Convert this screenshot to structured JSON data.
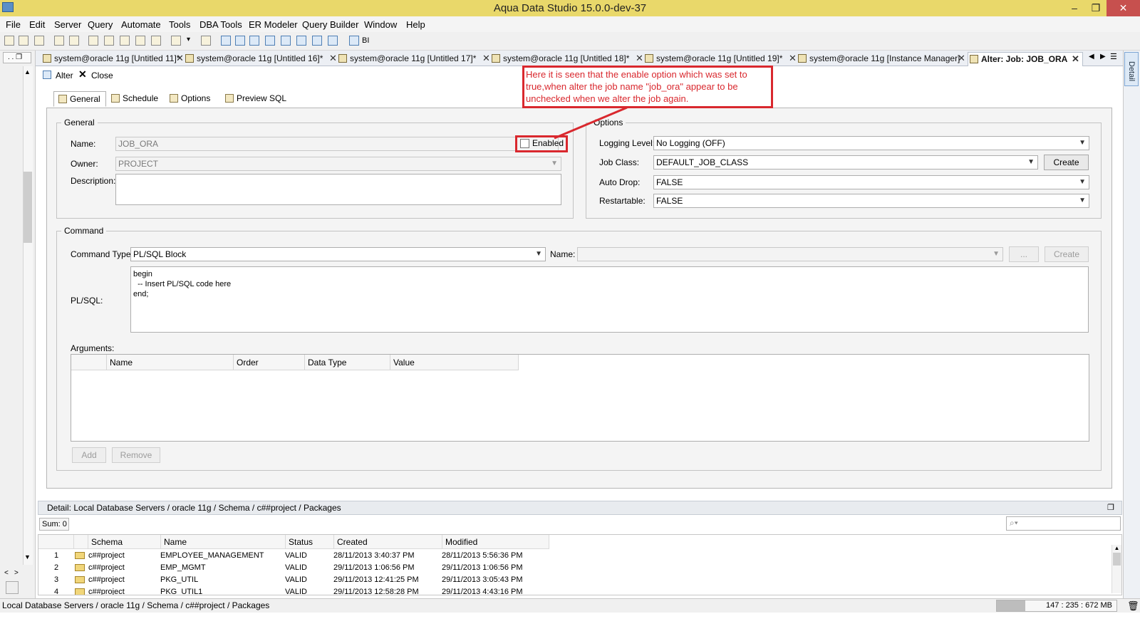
{
  "window": {
    "title": "Aqua Data Studio 15.0.0-dev-37"
  },
  "menu": [
    "File",
    "Edit",
    "Server",
    "Query",
    "Automate",
    "Tools",
    "DBA Tools",
    "ER Modeler",
    "Query Builder",
    "Window",
    "Help"
  ],
  "toolbar": {
    "bi_label": "BI"
  },
  "editor_tabs": [
    {
      "label": "system@oracle 11g [Untitled 11]*"
    },
    {
      "label": "system@oracle 11g [Untitled 16]*"
    },
    {
      "label": "system@oracle 11g [Untitled 17]*"
    },
    {
      "label": "system@oracle 11g [Untitled 18]*"
    },
    {
      "label": "system@oracle 11g [Untitled 19]*"
    },
    {
      "label": "system@oracle 11g [Instance Manager]"
    },
    {
      "label": "Alter: Job: JOB_ORA"
    }
  ],
  "right_strip": {
    "label": "Detail"
  },
  "alter_toolbar": {
    "alter_label": "Alter",
    "close_label": "Close"
  },
  "subtabs": [
    "General",
    "Schedule",
    "Options",
    "Preview SQL"
  ],
  "general": {
    "legend": "General",
    "name_label": "Name:",
    "name_value": "JOB_ORA",
    "enabled_label": "Enabled",
    "enabled_checked": false,
    "owner_label": "Owner:",
    "owner_value": "PROJECT",
    "description_label": "Description:",
    "description_value": ""
  },
  "options": {
    "legend": "Options",
    "logging_label": "Logging Level:",
    "logging_value": "No Logging (OFF)",
    "jobclass_label": "Job Class:",
    "jobclass_value": "DEFAULT_JOB_CLASS",
    "create_label": "Create",
    "autodrop_label": "Auto Drop:",
    "autodrop_value": "FALSE",
    "restartable_label": "Restartable:",
    "restartable_value": "FALSE"
  },
  "command": {
    "legend": "Command",
    "type_label": "Command Type:",
    "type_value": "PL/SQL Block",
    "name_label": "Name:",
    "name_value": "",
    "ellipsis_label": "...",
    "create_label": "Create",
    "plsql_label": "PL/SQL:",
    "plsql_code": "begin\n  -- Insert PL/SQL code here\nend;",
    "arguments_label": "Arguments:",
    "arguments_columns": [
      "Name",
      "Order",
      "Data Type",
      "Value"
    ],
    "add_label": "Add",
    "remove_label": "Remove"
  },
  "annotation": {
    "text": "Here it is seen that the enable option which was set to true,when alter the job name \"job_ora\" appear to be unchecked when we alter the job again."
  },
  "detail": {
    "header": "Detail: Local Database Servers / oracle 11g / Schema / c##project / Packages",
    "sum_label": "Sum: 0",
    "columns": [
      "Schema",
      "Name",
      "Status",
      "Created",
      "Modified"
    ],
    "rows": [
      {
        "num": "1",
        "schema": "c##project",
        "name": "EMPLOYEE_MANAGEMENT",
        "status": "VALID",
        "created": "28/11/2013 3:40:37 PM",
        "modified": "28/11/2013 5:56:36 PM"
      },
      {
        "num": "2",
        "schema": "c##project",
        "name": "EMP_MGMT",
        "status": "VALID",
        "created": "29/11/2013 1:06:56 PM",
        "modified": "29/11/2013 1:06:56 PM"
      },
      {
        "num": "3",
        "schema": "c##project",
        "name": "PKG_UTIL",
        "status": "VALID",
        "created": "29/11/2013 12:41:25 PM",
        "modified": "29/11/2013 3:05:43 PM"
      },
      {
        "num": "4",
        "schema": "c##project",
        "name": "PKG_UTIL1",
        "status": "VALID",
        "created": "29/11/2013 12:58:28 PM",
        "modified": "29/11/2013 4:43:16 PM"
      }
    ]
  },
  "status": {
    "path": "Local Database Servers / oracle 11g / Schema / c##project / Packages",
    "memory": "147 : 235 : 672 MB"
  },
  "colors": {
    "titlebar": "#e9d86a",
    "annotation": "#d9282e",
    "close_button": "#c7504e"
  }
}
